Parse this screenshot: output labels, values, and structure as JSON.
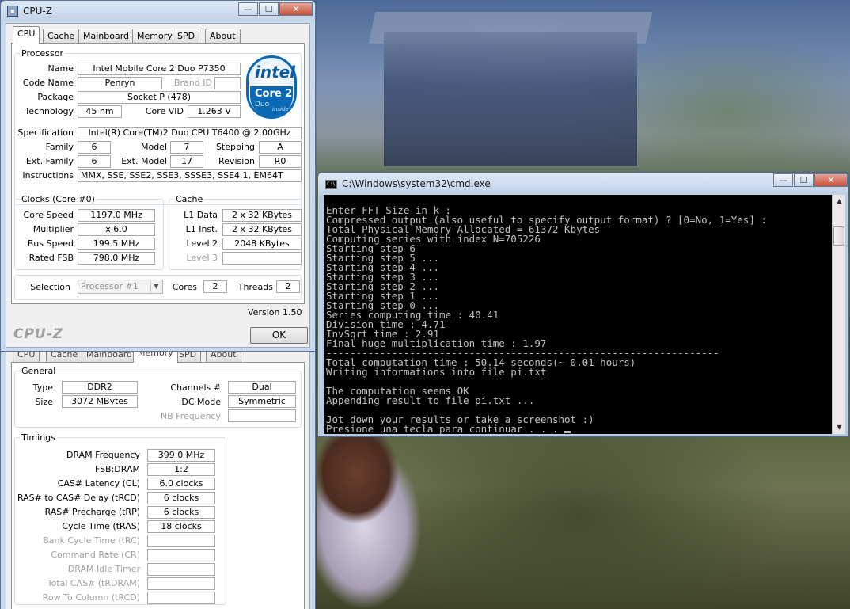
{
  "cpuz": {
    "title": "CPU-Z",
    "window_buttons": {
      "minimize": "—",
      "maximize": "☐",
      "close": "✕"
    },
    "tabs": [
      "CPU",
      "Cache",
      "Mainboard",
      "Memory",
      "SPD",
      "About"
    ],
    "processor": {
      "legend": "Processor",
      "name_label": "Name",
      "name": "Intel Mobile Core 2 Duo P7350",
      "codename_label": "Code Name",
      "codename": "Penryn",
      "brand_id_label": "Brand ID",
      "brand_id": "",
      "package_label": "Package",
      "package": "Socket P (478)",
      "technology_label": "Technology",
      "technology": "45 nm",
      "core_vid_label": "Core VID",
      "core_vid": "1.263 V",
      "specification_label": "Specification",
      "specification": "Intel(R) Core(TM)2 Duo CPU     T6400  @ 2.00GHz",
      "family_label": "Family",
      "family": "6",
      "model_label": "Model",
      "model": "7",
      "stepping_label": "Stepping",
      "stepping": "A",
      "ext_family_label": "Ext. Family",
      "ext_family": "6",
      "ext_model_label": "Ext. Model",
      "ext_model": "17",
      "revision_label": "Revision",
      "revision": "R0",
      "instructions_label": "Instructions",
      "instructions": "MMX, SSE, SSE2, SSE3, SSSE3, SSE4.1, EM64T"
    },
    "logo": {
      "intel": "intel",
      "core2": "Core 2",
      "duo": "Duo",
      "inside": "inside"
    },
    "clocks": {
      "legend": "Clocks (Core #0)",
      "core_speed_label": "Core Speed",
      "core_speed": "1197.0 MHz",
      "multiplier_label": "Multiplier",
      "multiplier": "x 6.0",
      "bus_speed_label": "Bus Speed",
      "bus_speed": "199.5 MHz",
      "rated_fsb_label": "Rated FSB",
      "rated_fsb": "798.0 MHz"
    },
    "cache": {
      "legend": "Cache",
      "l1_data_label": "L1 Data",
      "l1_data": "2 x 32 KBytes",
      "l1_inst_label": "L1 Inst.",
      "l1_inst": "2 x 32 KBytes",
      "level2_label": "Level 2",
      "level2": "2048 KBytes",
      "level3_label": "Level 3",
      "level3": ""
    },
    "selection_label": "Selection",
    "selection": "Processor #1",
    "cores_label": "Cores",
    "cores": "2",
    "threads_label": "Threads",
    "threads": "2",
    "version": "Version 1.50",
    "brand": "CPU-Z",
    "ok": "OK"
  },
  "memory": {
    "tabs": [
      "CPU",
      "Cache",
      "Mainboard",
      "Memory",
      "SPD",
      "About"
    ],
    "general": {
      "legend": "General",
      "type_label": "Type",
      "type": "DDR2",
      "size_label": "Size",
      "size": "3072 MBytes",
      "channels_label": "Channels #",
      "channels": "Dual",
      "dc_mode_label": "DC Mode",
      "dc_mode": "Symmetric",
      "nb_freq_label": "NB Frequency",
      "nb_freq": ""
    },
    "timings": {
      "legend": "Timings",
      "rows": [
        {
          "label": "DRAM Frequency",
          "value": "399.0 MHz",
          "dim": false
        },
        {
          "label": "FSB:DRAM",
          "value": "1:2",
          "dim": false
        },
        {
          "label": "CAS# Latency (CL)",
          "value": "6.0 clocks",
          "dim": false
        },
        {
          "label": "RAS# to CAS# Delay (tRCD)",
          "value": "6 clocks",
          "dim": false
        },
        {
          "label": "RAS# Precharge (tRP)",
          "value": "6 clocks",
          "dim": false
        },
        {
          "label": "Cycle Time (tRAS)",
          "value": "18 clocks",
          "dim": false
        },
        {
          "label": "Bank Cycle Time (tRC)",
          "value": "",
          "dim": true
        },
        {
          "label": "Command Rate (CR)",
          "value": "",
          "dim": true
        },
        {
          "label": "DRAM Idle Timer",
          "value": "",
          "dim": true
        },
        {
          "label": "Total CAS# (tRDRAM)",
          "value": "",
          "dim": true
        },
        {
          "label": "Row To Column (tRCD)",
          "value": "",
          "dim": true
        }
      ]
    }
  },
  "cmd": {
    "title": "C:\\Windows\\system32\\cmd.exe",
    "icon_text": "C:\\",
    "window_buttons": {
      "minimize": "—",
      "maximize": "☐",
      "close": "✕"
    },
    "lines": [
      "Enter FFT Size in k :",
      "Compressed output (also useful to specify output format) ? [0=No, 1=Yes] :",
      "Total Physical Memory Allocated = 61372 Kbytes",
      "Computing series with index N=705226",
      "Starting step 6",
      "Starting step 5 ...",
      "Starting step 4 ...",
      "Starting step 3 ...",
      "Starting step 2 ...",
      "Starting step 1 ...",
      "Starting step 0 ...",
      "Series computing time : 40.41",
      "Division time : 4.71",
      "InvSqrt time : 2.91",
      "Final huge multiplication time : 1.97",
      "------------------------------------------------------------------",
      "Total computation time : 50.14 seconds(~ 0.01 hours)",
      "Writing informations into file pi.txt",
      "",
      "The computation seems OK",
      "Appending result to file pi.txt ...",
      "",
      "Jot down your results or take a screenshot :)",
      "Presione una tecla para continuar . . . "
    ]
  }
}
